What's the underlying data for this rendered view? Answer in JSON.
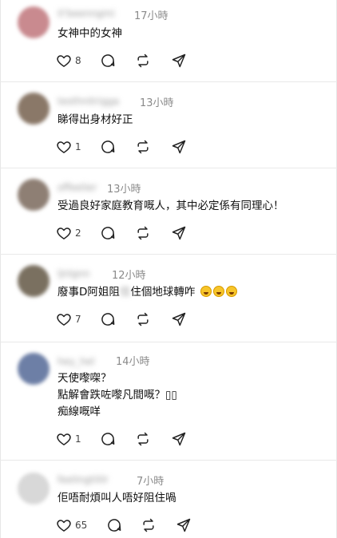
{
  "posts": [
    {
      "username": "it'beenngmi",
      "time": "17小時",
      "lines": [
        "女神中的女神"
      ],
      "likes": "8"
    },
    {
      "username": "testhnitrigga",
      "time": "13小時",
      "lines": [
        "睇得出身材好正"
      ],
      "likes": "1"
    },
    {
      "username": "offeelier",
      "time": "13小時",
      "lines": [
        "受過良好家庭教育嘅人，其中必定係有同理心！"
      ],
      "likes": "2"
    },
    {
      "username": "ljnlgnn",
      "time": "12小時",
      "text_before": "廢事D阿姐阻",
      "text_blur": "住",
      "text_after": "住個地球轉咋",
      "likes": "7"
    },
    {
      "username": "hey_hel",
      "time": "14小時",
      "lines": [
        "天使嚟㗎？",
        "點解會跌咗嚟凡間嘅？▯▯",
        "痴線嘅咩"
      ],
      "likes": "1"
    },
    {
      "username": "feelingtililr",
      "time": "7小時",
      "lines": [
        "佢唔耐煩叫人唔好阻住喎"
      ],
      "likes": "65"
    }
  ],
  "icons": {
    "like": "heart-icon",
    "reply": "comment-bubble-icon",
    "repost": "repost-icon",
    "share": "send-icon"
  },
  "colors": {
    "avatar_1": "#c98a8f",
    "avatar_2": "#8a7868",
    "avatar_3": "#8e7f74",
    "avatar_4": "#7a7060",
    "avatar_5": "#6d7fa6",
    "avatar_6": "#d8d8d8"
  }
}
